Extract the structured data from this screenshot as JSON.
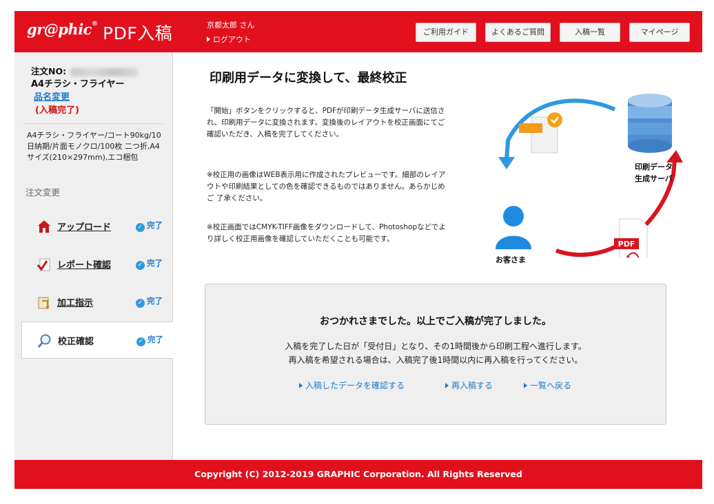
{
  "header": {
    "logo_text": "gr@phic",
    "logo_reg": "®",
    "app_title": "PDF入稿",
    "user_name": "京都太郎 さん",
    "logout_label": "ログアウト",
    "nav": [
      "ご利用ガイド",
      "よくあるご質問",
      "入稿一覧",
      "マイページ"
    ]
  },
  "sidebar": {
    "order_no_label": "注文NO:",
    "product_name": "A4チラシ・フライヤー",
    "change_product_label": "品名変更",
    "status_label": "(入稿完了)",
    "spec_text": "A4チラシ・フライヤー/コート90kg/10日納期/片面モノクロ/100枚 二つ折,A4サイズ(210×297mm),エコ梱包",
    "order_change_label": "注文変更",
    "steps": [
      {
        "label": "アップロード",
        "status": "完了",
        "icon": "upload-icon"
      },
      {
        "label": "レポート確認",
        "status": "完了",
        "icon": "report-check-icon"
      },
      {
        "label": "加工指示",
        "status": "完了",
        "icon": "processing-icon"
      },
      {
        "label": "校正確認",
        "status": "完了",
        "icon": "magnifier-icon"
      }
    ]
  },
  "main": {
    "title": "印刷用データに変換して、最終校正",
    "para1": "「開始」ボタンをクリックすると、PDFが印刷データ生成サーバに送信され、印刷用データに変換されます。変換後のレイアウトを校正画面にてご確認いただき、入稿を完了してください。",
    "para2": "※校正用の画像はWEB表示用に作成されたプレビューです。細部のレイアウトや印刷結果としての色を確認できるものではありません。あらかじめご 了承ください。",
    "para3": "※校正画面ではCMYK-TIFF画像をダウンロードして、Photoshopなどでより詳しく校正用画像を確認していただくことも可能です。",
    "diagram": {
      "server_label_1": "印刷データ",
      "server_label_2": "生成サーバ",
      "customer_label": "お客さま",
      "pdf_label": "PDF"
    },
    "result": {
      "title": "おつかれさまでした。以上でご入稿が完了しました。",
      "line1": "入稿を完了した日が「受付日」となり、その1時間後から印刷工程へ進行します。",
      "line2": "再入稿を希望される場合は、入稿完了後1時間以内に再入稿を行ってください。",
      "links": [
        "入稿したデータを確認する",
        "再入稿する",
        "一覧へ戻る"
      ]
    }
  },
  "footer": {
    "copyright": "Copyright (C) 2012-2019 GRAPHIC Corporation. All Rights Reserved"
  },
  "colors": {
    "brand_red": "#e2101d",
    "link_blue": "#1a7bd1",
    "status_red": "#cc1414"
  }
}
